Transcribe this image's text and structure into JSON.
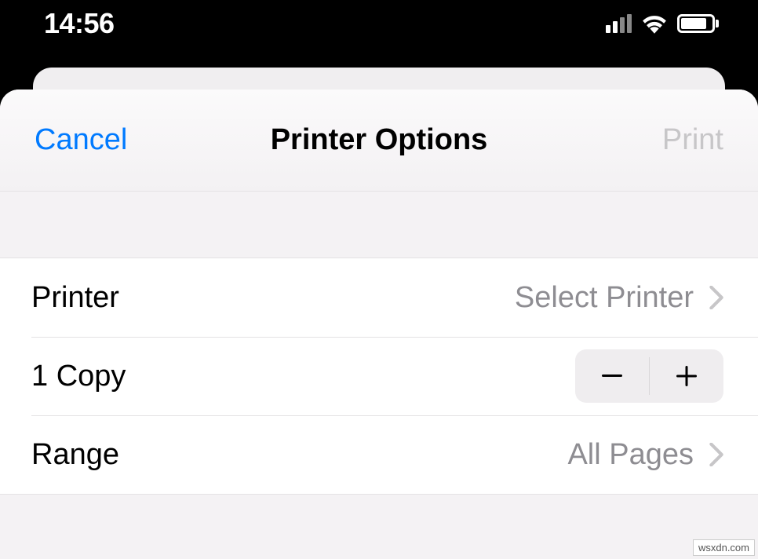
{
  "status": {
    "time": "14:56"
  },
  "nav": {
    "cancel": "Cancel",
    "title": "Printer Options",
    "print": "Print"
  },
  "rows": {
    "printer": {
      "label": "Printer",
      "value": "Select Printer"
    },
    "copies": {
      "label": "1 Copy"
    },
    "range": {
      "label": "Range",
      "value": "All Pages"
    }
  },
  "watermark": "wsxdn.com"
}
